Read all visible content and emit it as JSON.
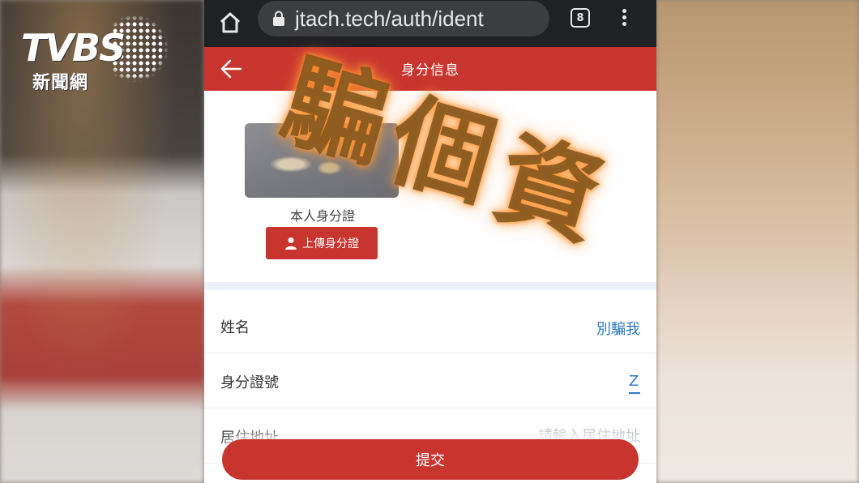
{
  "logo": {
    "wordmark": "TVBS",
    "subtitle": "新聞網"
  },
  "browser": {
    "url": "jtach.tech/auth/ident",
    "tab_count": "8"
  },
  "header": {
    "title": "身分信息"
  },
  "id_upload": {
    "photo_label": "本人身分證",
    "button_label": "上傳身分證"
  },
  "form": {
    "name_label": "姓名",
    "name_value": "別騙我",
    "id_number_label": "身分證號",
    "id_number_value": "Z",
    "address_label": "居住地址",
    "address_placeholder": "請輸入居住地址"
  },
  "submit_label": "提交",
  "overlay": {
    "stamp_text": [
      "騙",
      "個",
      "資"
    ]
  },
  "colors": {
    "accent": "#c8352f",
    "link": "#2f78c4",
    "browser_bar": "#202124"
  }
}
